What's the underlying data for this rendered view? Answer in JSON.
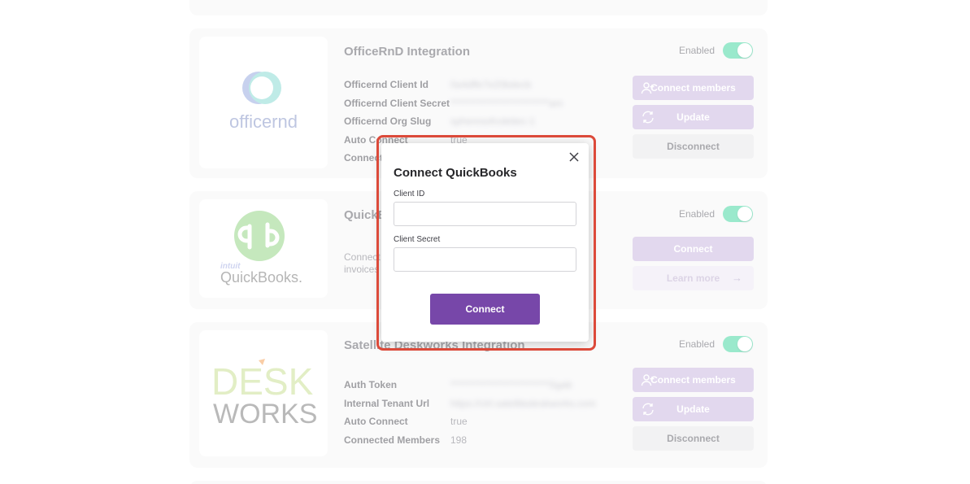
{
  "integrations": [
    {
      "title": "OfficeRnD Integration",
      "enabled_label": "Enabled",
      "logo_text": "officernd",
      "fields": [
        {
          "label": "Officernd Client Id",
          "value": "0a4dffe7e20bdecb"
        },
        {
          "label": "Officernd Client Secret",
          "value": "**************************am"
        },
        {
          "label": "Officernd Org Slug",
          "value": "spheresofcoletiec-1"
        },
        {
          "label": "Auto Connect",
          "value": "true"
        },
        {
          "label": "Connected Members",
          "value": ""
        }
      ],
      "buttons": {
        "connect_members": "Connect members",
        "update": "Update",
        "disconnect": "Disconnect"
      }
    },
    {
      "title": "QuickBooks",
      "enabled_label": "Enabled",
      "logo_brand": "intuit",
      "logo_text": "QuickBooks.",
      "description": "Connect your QuickBooks account to automatically sync invoices",
      "buttons": {
        "connect": "Connect",
        "learn_more": "Learn more"
      }
    },
    {
      "title": "Satellite Deskworks Integration",
      "enabled_label": "Enabled",
      "logo_text_top": "DESK",
      "logo_text_bottom": "WORKS",
      "fields": [
        {
          "label": "Auth Token",
          "value": "**************************Sgab"
        },
        {
          "label": "Internal Tenant Url",
          "value": "https://ctrl.satellitedeskworks.com"
        },
        {
          "label": "Auto Connect",
          "value": "true"
        },
        {
          "label": "Connected Members",
          "value": "198"
        }
      ],
      "buttons": {
        "connect_members": "Connect members",
        "update": "Update",
        "disconnect": "Disconnect"
      }
    }
  ],
  "modal": {
    "title": "Connect QuickBooks",
    "client_id_label": "Client ID",
    "client_id_value": "",
    "client_secret_label": "Client Secret",
    "client_secret_value": "",
    "connect_button": "Connect"
  },
  "colors": {
    "accent": "#7747a9",
    "accent_faded": "#c4b0dc",
    "toggle_on": "#34d399",
    "highlight": "#dc4a3a"
  }
}
